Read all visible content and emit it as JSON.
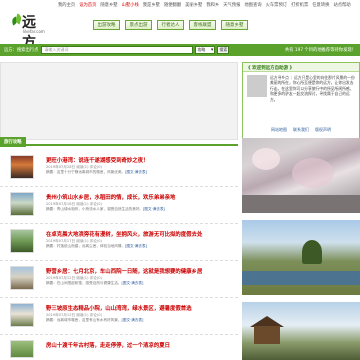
{
  "toplinks": [
    "我的主页",
    "设为首页",
    "随意乡墅",
    "山墅小栈",
    "我是乡墅",
    "随便翻翻",
    "美丽乡墅",
    "我和乡",
    "天气预报",
    "地图查询",
    "火车票预订",
    "打折机票",
    "任意转换",
    "站点帮助"
  ],
  "logo": {
    "text": "远方",
    "sub": "likefar.com"
  },
  "nav": [
    "出游攻略",
    "景点出游",
    "行者达人",
    "客栈联盟",
    "随意乡墅"
  ],
  "search": {
    "label": "远方：搜索出行点",
    "placeholder": "请输入关键词",
    "type_value": "攻略",
    "go_label": "搜索",
    "right_text": "共有 197 个目的地推荐等待你发现！"
  },
  "welcome": {
    "title": "《 欢迎到远方自助游 》",
    "text": "远方寻乡点 ：远方只是心里的向往那片风景的一份美丽的所在，你心所至便是你的远方，让你出发去行走。在这里你可以分享旅行中的所见所闻所感，和更多的驴友一起交流探讨，寻找属于自己的远方。",
    "links": [
      "网站地图",
      "联系我们",
      "版权声明"
    ]
  },
  "tips": {
    "title": "旅行攻略",
    "items": [
      {
        "title": "更旺小港湾：说连千遂湖感受到奇妙之夜！",
        "meta": "2019年07月28日 阅读(1) 评论(0)",
        "desc": "摘要：这里十分宁静远离城市的喧嚣，风景优美。",
        "tag": "[图文·满去表]"
      },
      {
        "title": "贵州小筑山水乡居，水稻田的情，成长，欢乐弟弟亲地",
        "meta": "2019年07月18日 阅读(1) 评论(0)",
        "desc": "摘要：青山绿水相伴，小桥流水人家，感受自然生活的美好。",
        "tag": "[图文·满去表]"
      },
      {
        "title": "在卓克晨大地滨旁花有漫树，坐拥风火，旅游无可比拟的度假去处",
        "meta": "2019年07月17日 阅读(1) 评论(0)",
        "desc": "摘要：村落依山而建，远离尘嚣，体验当地风情。",
        "tag": "[图文·满去表]"
      },
      {
        "title": "野营乡居：七月北京，车山西院一日随，这就是我想要的健康乡居",
        "meta": "2019年07月12日 阅读(1) 评论(0)",
        "desc": "摘要：在山间搭起帐篷，感受自然与健康生活。",
        "tag": "[图文·满去表]"
      },
      {
        "title": "野三坡原生态精品小院，山山湾湾，绿水景区，避暑度假首选",
        "meta": "2019年07月12日 阅读(1) 评论(0)",
        "desc": "摘要：远离城市喧嚣，这里有山有水有好风景。",
        "tag": "[图文·满去表]"
      },
      {
        "title": "房山十渡千年古村落，走走停停，过一个清凉的夏日",
        "meta": "",
        "desc": "",
        "tag": ""
      }
    ]
  },
  "colors": {
    "accent": "#5ba22c",
    "title_red": "#cc0000"
  },
  "icons": {
    "logo": "leaf-logo-icon"
  }
}
